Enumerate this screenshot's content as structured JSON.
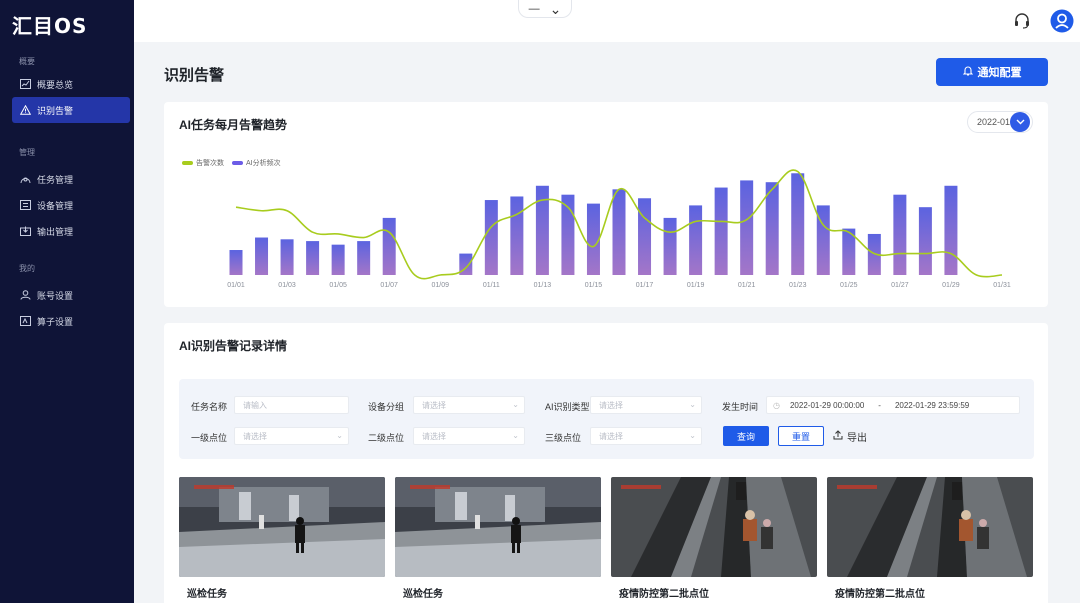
{
  "app": {
    "logo_text": "汇目OS"
  },
  "sidebar": {
    "groups": [
      {
        "label": "概要",
        "items": [
          {
            "label": "概要总览",
            "icon": "chart-icon"
          },
          {
            "label": "识别告警",
            "icon": "warning-icon",
            "active": true
          }
        ]
      },
      {
        "label": "管理",
        "items": [
          {
            "label": "任务管理",
            "icon": "task-icon"
          },
          {
            "label": "设备管理",
            "icon": "device-icon"
          },
          {
            "label": "输出管理",
            "icon": "output-icon"
          }
        ]
      },
      {
        "label": "我的",
        "items": [
          {
            "label": "账号设置",
            "icon": "user-icon"
          },
          {
            "label": "算子设置",
            "icon": "operator-icon"
          }
        ]
      }
    ]
  },
  "topbar": {
    "collapse_minus": "—",
    "collapse_chevron": "⌄",
    "support_icon": "headset-icon",
    "avatar_icon": "avatar-icon"
  },
  "page": {
    "title": "识别告警",
    "notify_button": "通知配置"
  },
  "trend_card": {
    "title": "AI任务每月告警趋势",
    "month": "2022-01"
  },
  "chart_data": {
    "type": "bar",
    "categories": [
      "01/01",
      "01/02",
      "01/03",
      "01/04",
      "01/05",
      "01/06",
      "01/07",
      "01/08",
      "01/09",
      "01/10",
      "01/11",
      "01/12",
      "01/13",
      "01/14",
      "01/15",
      "01/16",
      "01/17",
      "01/18",
      "01/19",
      "01/20",
      "01/21",
      "01/22",
      "01/23",
      "01/24",
      "01/25",
      "01/26",
      "01/27",
      "01/28",
      "01/29",
      "01/30",
      "01/31"
    ],
    "x_tick_labels": [
      "01/01",
      "01/03",
      "01/05",
      "01/07",
      "01/09",
      "01/11",
      "01/13",
      "01/15",
      "01/17",
      "01/19",
      "01/21",
      "01/23",
      "01/25",
      "01/27",
      "01/29",
      "01/31"
    ],
    "series": [
      {
        "name": "告警次数",
        "kind": "line",
        "color": "#a8cc1e",
        "values": [
          38,
          36,
          36,
          24,
          23,
          21,
          24,
          0,
          0,
          4,
          27,
          34,
          42,
          38,
          16,
          48,
          32,
          24,
          30,
          30,
          31,
          48,
          58,
          28,
          24,
          12,
          12,
          12,
          12,
          0,
          0
        ]
      },
      {
        "name": "AI分析频次",
        "kind": "bar",
        "color": "#6c5ce7",
        "values": [
          14,
          21,
          20,
          19,
          17,
          19,
          32,
          0,
          0,
          12,
          42,
          44,
          50,
          45,
          40,
          48,
          43,
          32,
          39,
          49,
          53,
          52,
          57,
          39,
          26,
          23,
          45,
          38,
          50,
          0,
          0
        ]
      }
    ],
    "ylim": [
      0,
      65
    ],
    "legend_position": "top-left",
    "grid": false
  },
  "records_card": {
    "title": "AI识别告警记录详情",
    "filters": {
      "task_name": {
        "label": "任务名称",
        "placeholder": "请输入"
      },
      "device_group": {
        "label": "设备分组",
        "placeholder": "请选择"
      },
      "ai_type": {
        "label": "AI识别类型",
        "placeholder": "请选择"
      },
      "time": {
        "label": "发生时间",
        "start": "2022-01-29 00:00:00",
        "separator": "-",
        "end": "2022-01-29 23:59:59"
      },
      "level1": {
        "label": "一级点位",
        "placeholder": "请选择"
      },
      "level2": {
        "label": "二级点位",
        "placeholder": "请选择"
      },
      "level3": {
        "label": "三级点位",
        "placeholder": "请选择"
      }
    },
    "buttons": {
      "query": "查询",
      "reset": "重置",
      "export": "导出"
    },
    "thumbnails": [
      {
        "caption": "巡检任务",
        "scene": "hall"
      },
      {
        "caption": "巡检任务",
        "scene": "hall"
      },
      {
        "caption": "疫情防控第二批点位",
        "scene": "escalator"
      },
      {
        "caption": "疫情防控第二批点位",
        "scene": "escalator"
      }
    ]
  },
  "colors": {
    "sidebar_bg": "#0f1437",
    "active_nav": "#2436a8",
    "primary": "#1f5be8",
    "bar_top": "#6c5ce7",
    "line": "#a8cc1e"
  }
}
